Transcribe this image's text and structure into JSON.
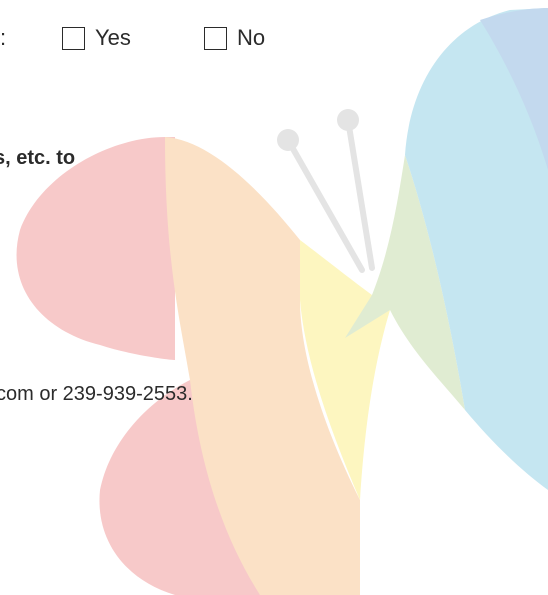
{
  "question": {
    "tail_text": ":"
  },
  "options": {
    "yes_label": "Yes",
    "no_label": "No"
  },
  "instruction": {
    "bold_text": "s, etc. to"
  },
  "contact": {
    "text": "com or 239-939-2553."
  },
  "watermark": {
    "icon": "butterfly-logo",
    "colors": [
      "#f7c9c9",
      "#fbe1c6",
      "#fdf6c0",
      "#e0ecd2",
      "#c5e6f1",
      "#c3d9ee"
    ]
  }
}
